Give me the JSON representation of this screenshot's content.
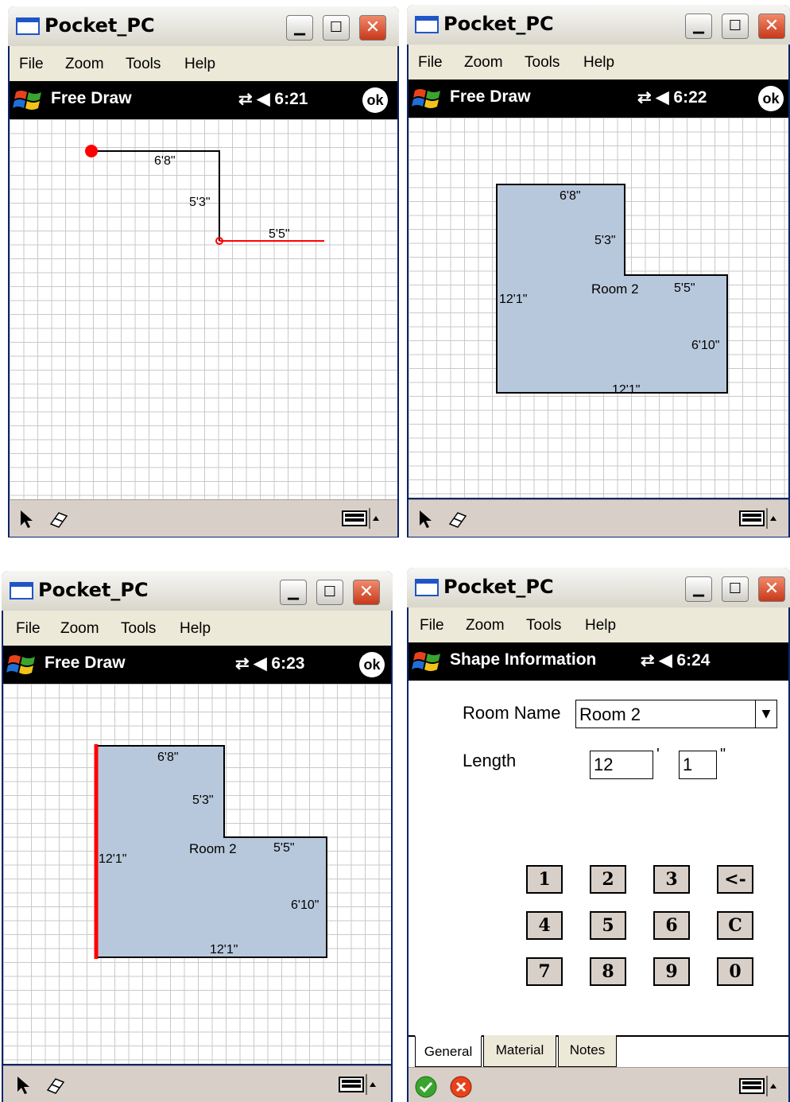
{
  "windows": [
    {
      "title": "Pocket_PC",
      "menu": [
        "File",
        "Zoom",
        "Tools",
        "Help"
      ],
      "command_title": "Free Draw",
      "time": "6:21",
      "ok_label": "ok",
      "dims": [
        "6'8\"",
        "5'3\"",
        "5'5\""
      ]
    },
    {
      "title": "Pocket_PC",
      "menu": [
        "File",
        "Zoom",
        "Tools",
        "Help"
      ],
      "command_title": "Free Draw",
      "time": "6:22",
      "ok_label": "ok",
      "room_name": "Room 2",
      "dims": [
        "6'8\"",
        "5'3\"",
        "5'5\"",
        "12'1\"",
        "6'10\"",
        "12'1\""
      ]
    },
    {
      "title": "Pocket_PC",
      "menu": [
        "File",
        "Zoom",
        "Tools",
        "Help"
      ],
      "command_title": "Free Draw",
      "time": "6:23",
      "ok_label": "ok",
      "room_name": "Room 2",
      "dims": [
        "6'8\"",
        "5'3\"",
        "5'5\"",
        "12'1\"",
        "6'10\"",
        "12'1\""
      ]
    },
    {
      "title": "Pocket_PC",
      "menu": [
        "File",
        "Zoom",
        "Tools",
        "Help"
      ],
      "command_title": "Shape Information",
      "time": "6:24",
      "form": {
        "room_name_label": "Room Name",
        "room_name_value": "Room 2",
        "length_label": "Length",
        "feet_value": "12",
        "feet_unit": "'",
        "inches_value": "1",
        "inches_unit": "\"",
        "keypad": [
          "1",
          "2",
          "3",
          "<-",
          "4",
          "5",
          "6",
          "C",
          "7",
          "8",
          "9",
          "0"
        ],
        "tabs": [
          "General",
          "Material",
          "Notes"
        ],
        "active_tab": "General"
      }
    }
  ],
  "colors": {
    "fill": "#b8c8dc",
    "highlight": "#ff0000",
    "grid": "#c9c9c9"
  }
}
